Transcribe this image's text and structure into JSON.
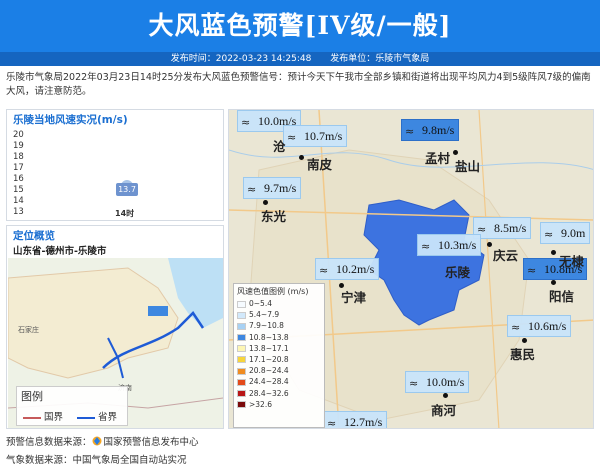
{
  "header": {
    "title": "大风蓝色预警[IV级/一般]",
    "publish_time": "发布时间：2022-03-23 14:25:48",
    "publisher": "发布单位：乐陵市气象局"
  },
  "description": "乐陵市气象局2022年03月23日14时25分发布大风蓝色预警信号：预计今天下午我市全部乡镇和街道将出现平均风力4到5级阵风7级的偏南大风，请注意防范。",
  "wind_panel": {
    "title": "乐陵当地风速实况(m/s)",
    "y_ticks": [
      "20",
      "19",
      "18",
      "17",
      "16",
      "15",
      "14",
      "13"
    ]
  },
  "chart_data": {
    "type": "scatter",
    "title": "乐陵当地风速实况(m/s)",
    "x": [
      "14时"
    ],
    "values": [
      13.7
    ],
    "ylim": [
      13,
      20
    ],
    "data_labels": [
      "13.7"
    ]
  },
  "location_panel": {
    "title": "定位概览",
    "name": "山东省-德州市-乐陵市",
    "legend_title": "图例",
    "legend_national": "国界",
    "legend_provincial": "省界",
    "map_labels": [
      "石家庄",
      "济南"
    ]
  },
  "main_map": {
    "wind_tags": [
      "10.0m/s",
      "10.7m/s",
      "9.8m/s",
      "9.7m/s",
      "8.5m/s",
      "10.3m/s",
      "9.0m",
      "10.2m/s",
      "10.8m/s",
      "10.6m/s",
      "10.0m/s",
      "12.7m/s"
    ],
    "places": [
      "沧",
      "南皮",
      "孟村",
      "盐山",
      "东光",
      "庆云",
      "无棣",
      "乐陵",
      "宁津",
      "阳信",
      "惠民",
      "商河"
    ],
    "legend_title": "风速色值图例 (m/s)",
    "legend_items": [
      {
        "label": "0~5.4",
        "color": "#f6fbff"
      },
      {
        "label": "5.4~7.9",
        "color": "#d2e9fb"
      },
      {
        "label": "7.9~10.8",
        "color": "#a7d1f3"
      },
      {
        "label": "10.8~13.8",
        "color": "#3d87e0"
      },
      {
        "label": "13.8~17.1",
        "color": "#fdf6b4"
      },
      {
        "label": "17.1~20.8",
        "color": "#f7d53b"
      },
      {
        "label": "20.8~24.4",
        "color": "#f08c21"
      },
      {
        "label": "24.4~28.4",
        "color": "#e34a1a"
      },
      {
        "label": "28.4~32.6",
        "color": "#b81515"
      },
      {
        "label": ">32.6",
        "color": "#7a0a0a"
      }
    ],
    "warning_color": "#3d6fe0"
  },
  "footer": {
    "warning_source": "预警信息数据来源：",
    "warning_source_name": "国家预警信息发布中心",
    "weather_source": "气象数据来源：中国气象局全国自动站实况"
  }
}
